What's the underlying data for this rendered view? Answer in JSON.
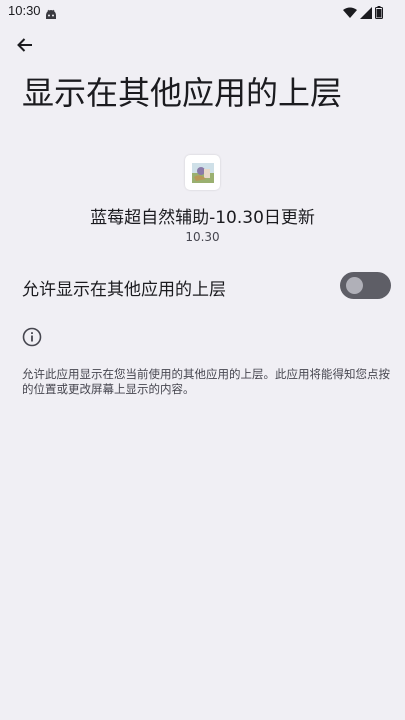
{
  "status_bar": {
    "time": "10:30",
    "notification_icon": "android-robot-icon",
    "icons": [
      "wifi-icon",
      "cell-signal-icon",
      "battery-icon"
    ]
  },
  "header": {
    "back_icon": "arrow-back-icon",
    "title": "显示在其他应用的上层"
  },
  "app": {
    "icon": "app-icon",
    "name": "蓝莓超自然辅助-10.30日更新",
    "version": "10.30"
  },
  "permission": {
    "label": "允许显示在其他应用的上层",
    "enabled": false
  },
  "info": {
    "icon": "info-icon",
    "description": "允许此应用显示在您当前使用的其他应用的上层。此应用将能得知您点按的位置或更改屏幕上显示的内容。"
  },
  "colors": {
    "background": "#f0eff4",
    "toggle_track": "#5e5e66",
    "toggle_knob": "#b0b0b8"
  }
}
